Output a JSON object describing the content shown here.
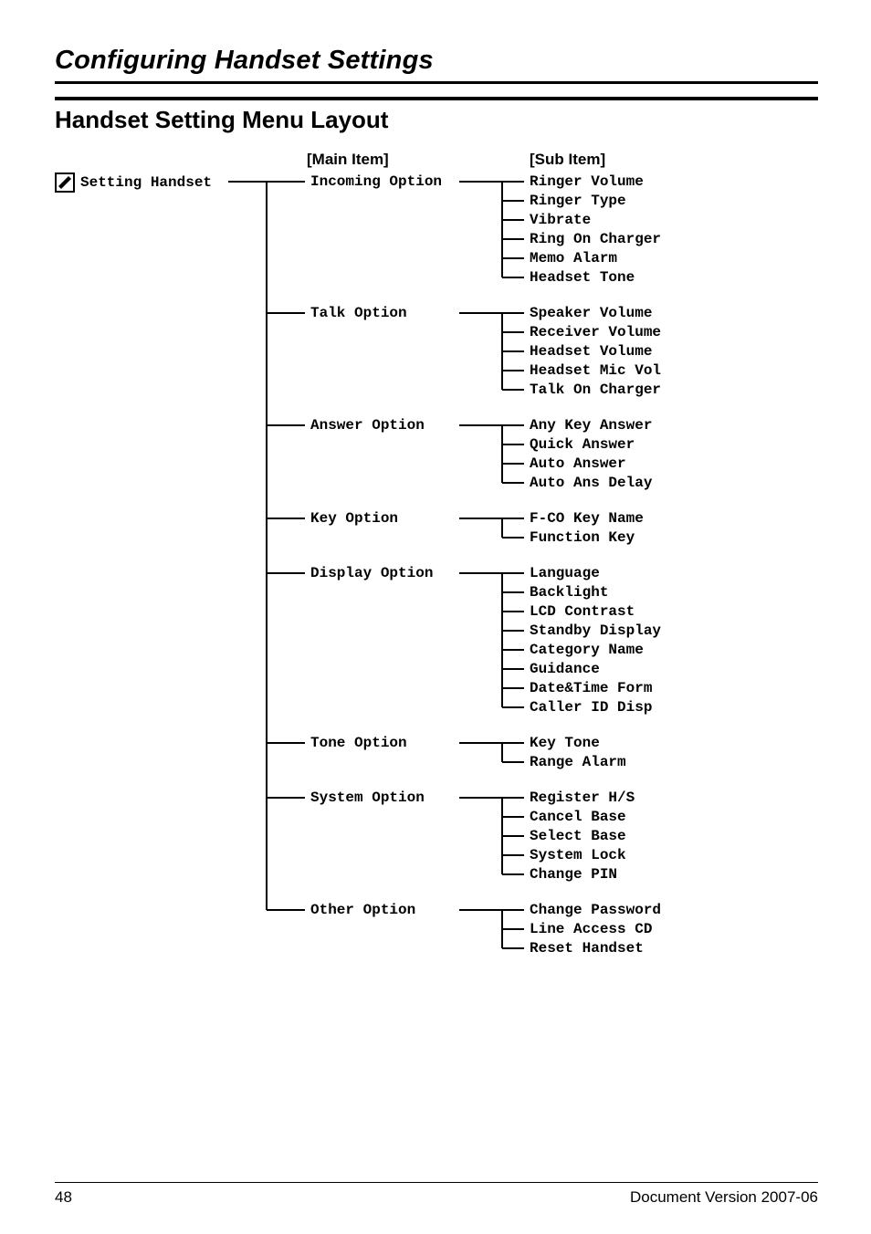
{
  "header": {
    "title": "Configuring Handset Settings"
  },
  "section": {
    "title": "Handset Setting Menu Layout"
  },
  "columns": {
    "main": "[Main Item]",
    "sub": "[Sub Item]"
  },
  "root": {
    "label": "Setting Handset"
  },
  "menu": [
    {
      "label": "Incoming Option",
      "items": [
        "Ringer Volume",
        "Ringer Type",
        "Vibrate",
        "Ring On Charger",
        "Memo Alarm",
        "Headset Tone"
      ]
    },
    {
      "label": "Talk Option",
      "items": [
        "Speaker Volume",
        "Receiver Volume",
        "Headset Volume",
        "Headset Mic Vol",
        "Talk On Charger"
      ]
    },
    {
      "label": "Answer Option",
      "items": [
        "Any Key Answer",
        "Quick Answer",
        "Auto Answer",
        "Auto Ans Delay"
      ]
    },
    {
      "label": "Key Option",
      "items": [
        "F-CO Key Name",
        "Function Key"
      ]
    },
    {
      "label": "Display Option",
      "items": [
        "Language",
        "Backlight",
        "LCD Contrast",
        "Standby Display",
        "Category Name",
        "Guidance",
        "Date&Time Form",
        "Caller ID Disp"
      ]
    },
    {
      "label": "Tone Option",
      "items": [
        "Key Tone",
        "Range Alarm"
      ]
    },
    {
      "label": "System Option",
      "items": [
        "Register H/S",
        "Cancel Base",
        "Select Base",
        "System Lock",
        "Change PIN"
      ]
    },
    {
      "label": "Other Option",
      "items": [
        "Change Password",
        "Line Access CD",
        "Reset Handset"
      ]
    }
  ],
  "footer": {
    "page": "48",
    "version": "Document Version 2007-06"
  }
}
